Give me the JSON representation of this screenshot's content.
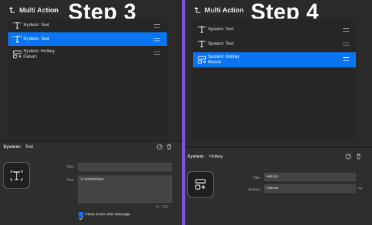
{
  "left": {
    "header": {
      "title": "Multi Action"
    },
    "step_label": "Step 3",
    "actions": [
      {
        "label": "System: Text",
        "sub": "",
        "selected": false,
        "icon": "text-cursor-icon"
      },
      {
        "label": "System: Text",
        "sub": "",
        "selected": true,
        "icon": "text-cursor-icon"
      },
      {
        "label": "System: Hotkey",
        "sub": "Return",
        "selected": false,
        "icon": "hotkey-icon"
      }
    ],
    "properties": {
      "plugin": "System:",
      "action": "Text",
      "title_label": "Title:",
      "title_value": "",
      "text_label": "Text:",
      "text_value": "/c potionclass",
      "counter": "14 / 500",
      "checkbox_label": "Press Enter after message",
      "checkbox_checked": true
    }
  },
  "right": {
    "header": {
      "title": "Multi Action"
    },
    "step_label": "Step 4",
    "actions": [
      {
        "label": "System: Text",
        "sub": "",
        "selected": false,
        "icon": "text-cursor-icon"
      },
      {
        "label": "System: Text",
        "sub": "",
        "selected": false,
        "icon": "text-cursor-icon"
      },
      {
        "label": "System: Hotkey",
        "sub": "Return",
        "selected": true,
        "icon": "hotkey-icon"
      }
    ],
    "properties": {
      "plugin": "System:",
      "action": "Hotkey",
      "title_label": "Title:",
      "title_value": "Return",
      "hotkey_label": "Hotkey:",
      "hotkey_value": "Return"
    }
  },
  "colors": {
    "selection": "#0a74f2",
    "divider": "#7d52d6",
    "background": "#2a2a2a"
  }
}
